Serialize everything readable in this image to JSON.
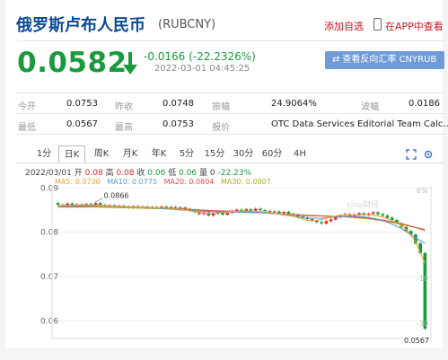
{
  "header": {
    "title": "俄罗斯卢布人民币",
    "code": "(RUBCNY)",
    "add_watch": "添加自选",
    "in_app": "在APP中查看"
  },
  "quote": {
    "price": "0.0582",
    "change": "-0.0166 (-22.2326%)",
    "time": "2022-03-01 04:45:25",
    "reverse_button": "查看反向汇率 CNYRUB"
  },
  "stats": {
    "open_label": "今开",
    "open": "0.0753",
    "prev_close_label": "昨收",
    "prev_close": "0.0748",
    "amplitude_label": "振幅",
    "amplitude": "24.9064%",
    "wave_label": "波幅",
    "wave": "0.0186",
    "low_label": "最低",
    "low": "0.0567",
    "high_label": "最高",
    "high": "0.0753",
    "source_label": "报价",
    "source": "OTC Data Services Editorial Team Calc..."
  },
  "tabs": [
    "1分",
    "日K",
    "周K",
    "月K",
    "年K",
    "5分",
    "15分",
    "30分",
    "60分",
    "4H"
  ],
  "active_tab": "日K",
  "ohlc": {
    "date": "2022/03/01",
    "open_label": "开",
    "open": "0.08",
    "high_label": "高",
    "high": "0.08",
    "close_label": "收",
    "close": "0.06",
    "low_label": "低",
    "low": "0.06",
    "vol_label": "量",
    "vol": "0",
    "pct": "-22.23%"
  },
  "ma_legend": {
    "ma5": "MA5: 0.0730",
    "ma10": "MA10: 0.0775",
    "ma20": "MA20: 0.0804",
    "ma30": "MA30: 0.0807"
  },
  "colors": {
    "up": "#e0252c",
    "down": "#1a9a3c",
    "brand": "#0c4a94",
    "ma5": "#f0a030",
    "ma10": "#5b9bd5",
    "ma20": "#e05050",
    "ma30": "#b0b020"
  },
  "chart_data": {
    "type": "candlestick",
    "y_ticks": [
      "0.09",
      "0.08",
      "0.07",
      "0.06"
    ],
    "ylim": [
      0.056,
      0.0905
    ],
    "right_ticks": [
      "6%",
      "-18",
      "-30"
    ],
    "high_marker": "0.0866",
    "low_marker": "0.0567",
    "watermark": "sina财经",
    "candles_close": [
      0.0862,
      0.0858,
      0.0865,
      0.086,
      0.0863,
      0.0861,
      0.0864,
      0.0862,
      0.0866,
      0.0862,
      0.0859,
      0.0861,
      0.0857,
      0.086,
      0.0858,
      0.0856,
      0.0859,
      0.0857,
      0.0858,
      0.0855,
      0.0857,
      0.0856,
      0.0858,
      0.0854,
      0.0857,
      0.0855,
      0.0856,
      0.0853,
      0.085,
      0.0846,
      0.0841,
      0.0845,
      0.0838,
      0.0842,
      0.0846,
      0.084,
      0.0844,
      0.0848,
      0.0851,
      0.0847,
      0.0852,
      0.0849,
      0.0853,
      0.085,
      0.0848,
      0.0845,
      0.0847,
      0.0843,
      0.0846,
      0.0842,
      0.0839,
      0.0836,
      0.0833,
      0.083,
      0.0826,
      0.0823,
      0.082,
      0.0825,
      0.0829,
      0.0834,
      0.0838,
      0.0841,
      0.0836,
      0.084,
      0.0843,
      0.0839,
      0.0842,
      0.0845,
      0.0841,
      0.0838,
      0.0833,
      0.0828,
      0.082,
      0.0812,
      0.0803,
      0.0795,
      0.0775,
      0.0753,
      0.0582
    ],
    "ma5": [
      0.086,
      0.0861,
      0.0862,
      0.0862,
      0.0861,
      0.086,
      0.0858,
      0.0858,
      0.0857,
      0.0857,
      0.0856,
      0.0855,
      0.0854,
      0.0851,
      0.0847,
      0.0843,
      0.0843,
      0.0845,
      0.0847,
      0.0848,
      0.0848,
      0.0847,
      0.0845,
      0.0842,
      0.0838,
      0.0832,
      0.0826,
      0.0827,
      0.0833,
      0.0838,
      0.084,
      0.0839,
      0.084,
      0.0838,
      0.0832,
      0.0823,
      0.0808,
      0.078,
      0.073
    ],
    "ma10": [
      0.0858,
      0.0859,
      0.086,
      0.086,
      0.086,
      0.0859,
      0.0858,
      0.0857,
      0.0856,
      0.0854,
      0.0852,
      0.085,
      0.0848,
      0.0847,
      0.0846,
      0.0846,
      0.0846,
      0.0845,
      0.0844,
      0.0842,
      0.0838,
      0.0834,
      0.0832,
      0.0832,
      0.0834,
      0.0836,
      0.0836,
      0.0834,
      0.0829,
      0.082,
      0.0808,
      0.079,
      0.0775
    ],
    "ma20": [
      0.0858,
      0.0858,
      0.0859,
      0.0859,
      0.0858,
      0.0857,
      0.0856,
      0.0855,
      0.0853,
      0.0851,
      0.0849,
      0.0848,
      0.0847,
      0.0845,
      0.0843,
      0.084,
      0.0838,
      0.0837,
      0.0836,
      0.0835,
      0.0833,
      0.0829,
      0.0823,
      0.0815,
      0.0804
    ],
    "ma30": [
      0.0857,
      0.0857,
      0.0857,
      0.0856,
      0.0855,
      0.0854,
      0.0853,
      0.0851,
      0.0849,
      0.0847,
      0.0845,
      0.0844,
      0.0842,
      0.084,
      0.0838,
      0.0836,
      0.0834,
      0.083,
      0.0824,
      0.0815,
      0.0807
    ]
  }
}
